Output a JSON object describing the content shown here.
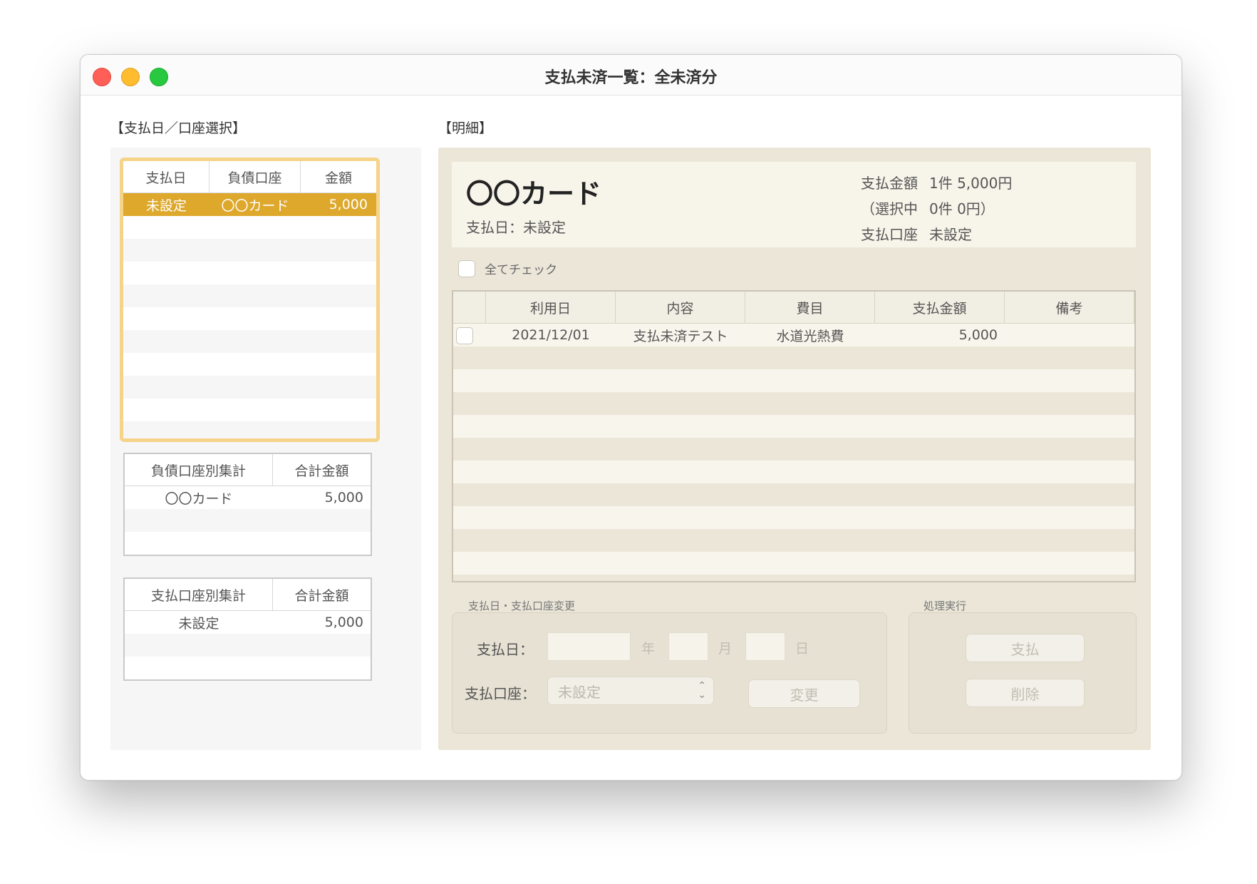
{
  "window": {
    "title": "支払未済一覧：全未済分"
  },
  "sections": {
    "left_label": "【支払日／口座選択】",
    "right_label": "【明細】"
  },
  "payment_table": {
    "columns": [
      "支払日",
      "負債口座",
      "金額"
    ],
    "rows": [
      {
        "date": "未設定",
        "account": "〇〇カード",
        "amount": "5,000"
      }
    ]
  },
  "liability_summary": {
    "columns": [
      "負債口座別集計",
      "合計金額"
    ],
    "rows": [
      {
        "account": "〇〇カード",
        "total": "5,000"
      }
    ]
  },
  "payment_account_summary": {
    "columns": [
      "支払口座別集計",
      "合計金額"
    ],
    "rows": [
      {
        "account": "未設定",
        "total": "5,000"
      }
    ]
  },
  "summary": {
    "card_name": "〇〇カード",
    "pay_date": "支払日：未設定",
    "amount_label": "支払金額",
    "amount_value": "1件 5,000円",
    "selected_label": "（選択中",
    "selected_value": "0件 0円）",
    "account_label": "支払口座",
    "account_value": "未設定"
  },
  "check_all": {
    "label": "全てチェック"
  },
  "details": {
    "columns": [
      "",
      "利用日",
      "内容",
      "費目",
      "支払金額",
      "備考"
    ],
    "rows": [
      {
        "date": "2021/12/01",
        "content": "支払未済テスト",
        "category": "水道光熱費",
        "amount": "5,000",
        "note": ""
      }
    ]
  },
  "change_group": {
    "label": "支払日・支払口座変更",
    "date_label": "支払日：",
    "year_unit": "年",
    "month_unit": "月",
    "day_unit": "日",
    "account_label": "支払口座：",
    "account_select": "未設定",
    "change_button": "変更"
  },
  "execute_group": {
    "label": "処理実行",
    "pay_button": "支払",
    "delete_button": "削除"
  }
}
